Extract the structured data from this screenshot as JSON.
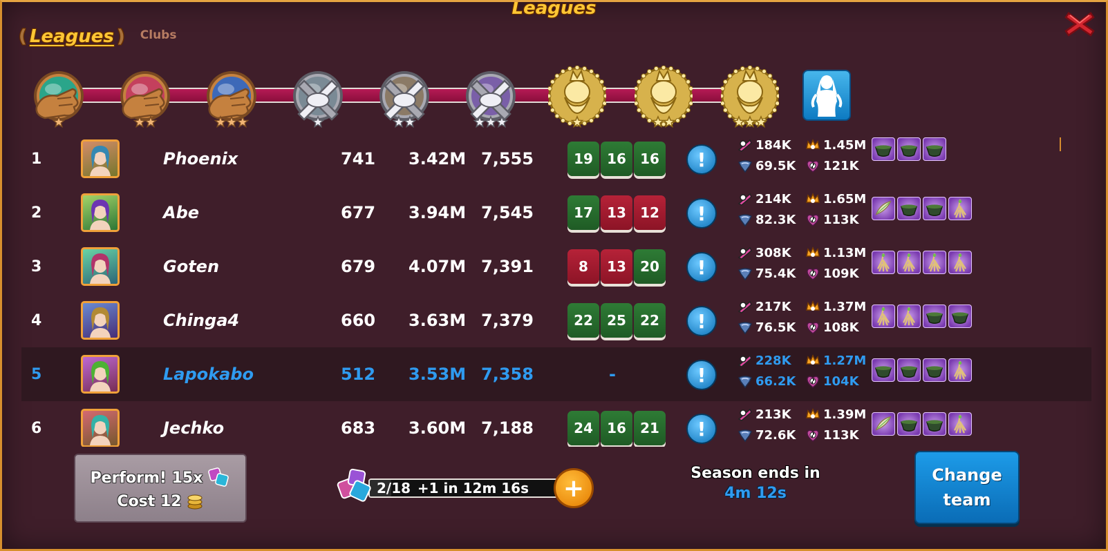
{
  "header": {
    "title": "Leagues",
    "tabs": {
      "leagues": "Leagues",
      "clubs": "Clubs"
    }
  },
  "icons": {
    "close": "close-x-icon",
    "info": "info-icon",
    "plus": "plus-icon"
  },
  "colors": {
    "accent_gold": "#ffc634",
    "my_row_blue": "#2f9bf0",
    "win": "#2e7b35",
    "loss": "#b62238"
  },
  "tiers": [
    {
      "name": "wood-1",
      "metal": "bronze-fist",
      "stars": 1
    },
    {
      "name": "wood-2",
      "metal": "bronze-fist",
      "stars": 2
    },
    {
      "name": "wood-3",
      "metal": "bronze-fist",
      "stars": 3
    },
    {
      "name": "silver-1",
      "metal": "silver-swords",
      "stars": 1
    },
    {
      "name": "silver-2",
      "metal": "silver-swords",
      "stars": 2
    },
    {
      "name": "silver-3",
      "metal": "silver-swords",
      "stars": 3
    },
    {
      "name": "gold-1",
      "metal": "gold-king",
      "stars": 1
    },
    {
      "name": "gold-2",
      "metal": "gold-king",
      "stars": 2
    },
    {
      "name": "gold-3",
      "metal": "gold-king",
      "stars": 3
    }
  ],
  "rows": [
    {
      "rank": "1",
      "name": "Phoenix",
      "flag": "fr",
      "level": "741",
      "power": "3.42M",
      "points": "7,555",
      "results": [
        {
          "v": "19",
          "r": "win"
        },
        {
          "v": "16",
          "r": "win"
        },
        {
          "v": "16",
          "r": "win"
        }
      ],
      "stats": {
        "ego": "184K",
        "harmony": "1.45M",
        "defense": "69.5K",
        "chance": "121K"
      },
      "boosters": [
        "bowl",
        "bowl",
        "bowl"
      ],
      "me": false
    },
    {
      "rank": "2",
      "name": "Abe",
      "flag": "de",
      "level": "677",
      "power": "3.94M",
      "points": "7,545",
      "results": [
        {
          "v": "17",
          "r": "win"
        },
        {
          "v": "13",
          "r": "loss"
        },
        {
          "v": "12",
          "r": "loss"
        }
      ],
      "stats": {
        "ego": "214K",
        "harmony": "1.65M",
        "defense": "82.3K",
        "chance": "113K"
      },
      "boosters": [
        "herb",
        "bowl",
        "bowl",
        "root"
      ],
      "me": false
    },
    {
      "rank": "3",
      "name": "Goten",
      "flag": "fr",
      "level": "679",
      "power": "4.07M",
      "points": "7,391",
      "results": [
        {
          "v": "8",
          "r": "loss"
        },
        {
          "v": "13",
          "r": "loss"
        },
        {
          "v": "20",
          "r": "win"
        }
      ],
      "stats": {
        "ego": "308K",
        "harmony": "1.13M",
        "defense": "75.4K",
        "chance": "109K"
      },
      "boosters": [
        "root",
        "root",
        "root",
        "root"
      ],
      "me": false
    },
    {
      "rank": "4",
      "name": "Chinga4",
      "flag": "ru",
      "level": "660",
      "power": "3.63M",
      "points": "7,379",
      "results": [
        {
          "v": "22",
          "r": "win"
        },
        {
          "v": "25",
          "r": "win"
        },
        {
          "v": "22",
          "r": "win"
        }
      ],
      "stats": {
        "ego": "217K",
        "harmony": "1.37M",
        "defense": "76.5K",
        "chance": "108K"
      },
      "boosters": [
        "root",
        "root",
        "bowl",
        "bowl"
      ],
      "me": false
    },
    {
      "rank": "5",
      "name": "Lapokabo",
      "flag": "fr",
      "level": "512",
      "power": "3.53M",
      "points": "7,358",
      "results": [],
      "dash": "-",
      "stats": {
        "ego": "228K",
        "harmony": "1.27M",
        "defense": "66.2K",
        "chance": "104K"
      },
      "boosters": [
        "bowl",
        "bowl",
        "bowl",
        "root"
      ],
      "me": true
    },
    {
      "rank": "6",
      "name": "Jechko",
      "flag": "pl",
      "level": "683",
      "power": "3.60M",
      "points": "7,188",
      "results": [
        {
          "v": "24",
          "r": "win"
        },
        {
          "v": "16",
          "r": "win"
        },
        {
          "v": "21",
          "r": "win"
        }
      ],
      "stats": {
        "ego": "213K",
        "harmony": "1.39M",
        "defense": "72.6K",
        "chance": "113K"
      },
      "boosters": [
        "herb",
        "bowl",
        "bowl",
        "root"
      ],
      "me": false
    }
  ],
  "perform": {
    "line1": "Perform! 15x",
    "line2": "Cost 12"
  },
  "energy": {
    "current": 2,
    "max": 18,
    "label": "2/18",
    "timer": "+1 in 12m 16s"
  },
  "season": {
    "label": "Season ends in",
    "countdown": "4m 12s"
  },
  "change_team": {
    "line1": "Change",
    "line2": "team"
  }
}
